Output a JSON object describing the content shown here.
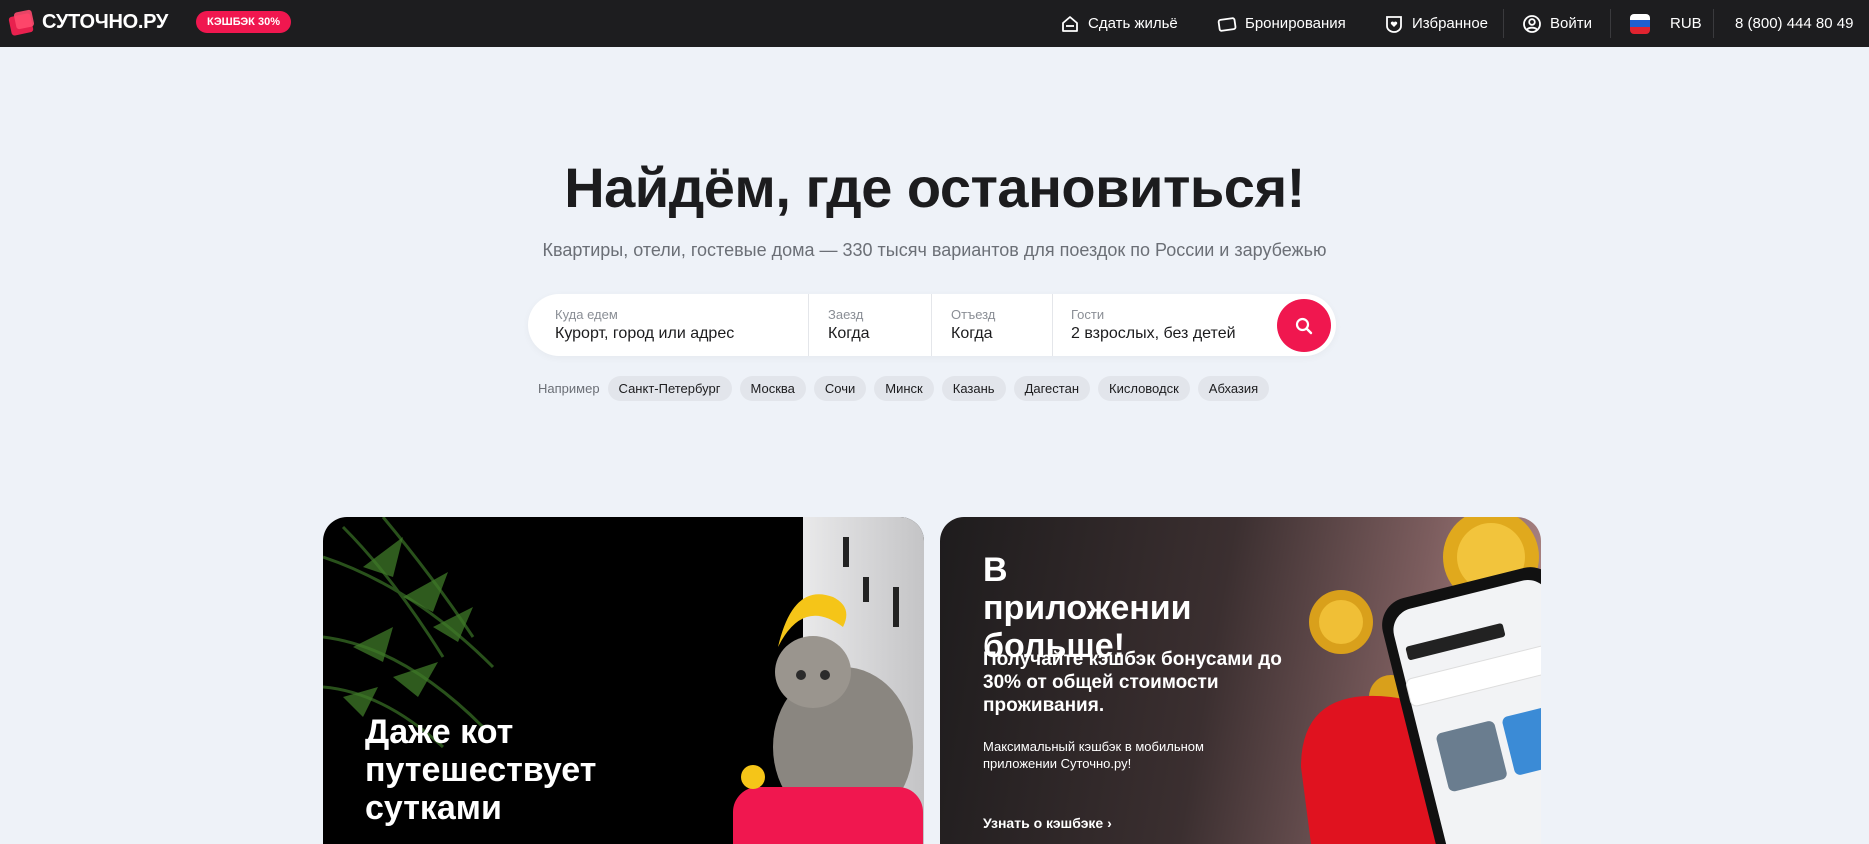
{
  "header": {
    "logo_text": "СУТОЧНО.РУ",
    "cashback_badge": "КЭШБЭК 30%",
    "nav": {
      "rent_out": "Сдать жильё",
      "bookings": "Бронирования",
      "favorites": "Избранное",
      "login": "Войти",
      "currency": "RUB",
      "phone": "8 (800) 444 80 49"
    }
  },
  "hero": {
    "title": "Найдём, где остановиться!",
    "subtitle": "Квартиры, отели, гостевые дома — 330 тысяч вариантов для поездок по России и зарубежью"
  },
  "search": {
    "destination": {
      "label": "Куда едем",
      "value": "Курорт, город или адрес"
    },
    "checkin": {
      "label": "Заезд",
      "value": "Когда"
    },
    "checkout": {
      "label": "Отъезд",
      "value": "Когда"
    },
    "guests": {
      "label": "Гости",
      "value": "2 взрослых, без детей"
    }
  },
  "examples": {
    "label": "Например",
    "chips": [
      "Санкт-Петербург",
      "Москва",
      "Сочи",
      "Минск",
      "Казань",
      "Дагестан",
      "Кисловодск",
      "Абхазия"
    ]
  },
  "cards": {
    "left": {
      "title": "Даже кот путешествует сутками"
    },
    "right": {
      "title": "В приложении больше!",
      "text1": "Получайте кэшбэк бонусами до 30% от общей стоимости проживания.",
      "text2": "Максимальный кэшбэк в мобильном приложении Суточно.ру!",
      "link": "Узнать о кэшбэке ›"
    }
  },
  "colors": {
    "accent": "#f0174f",
    "header_bg": "#1d1d1f",
    "page_bg": "#eef2f8"
  }
}
